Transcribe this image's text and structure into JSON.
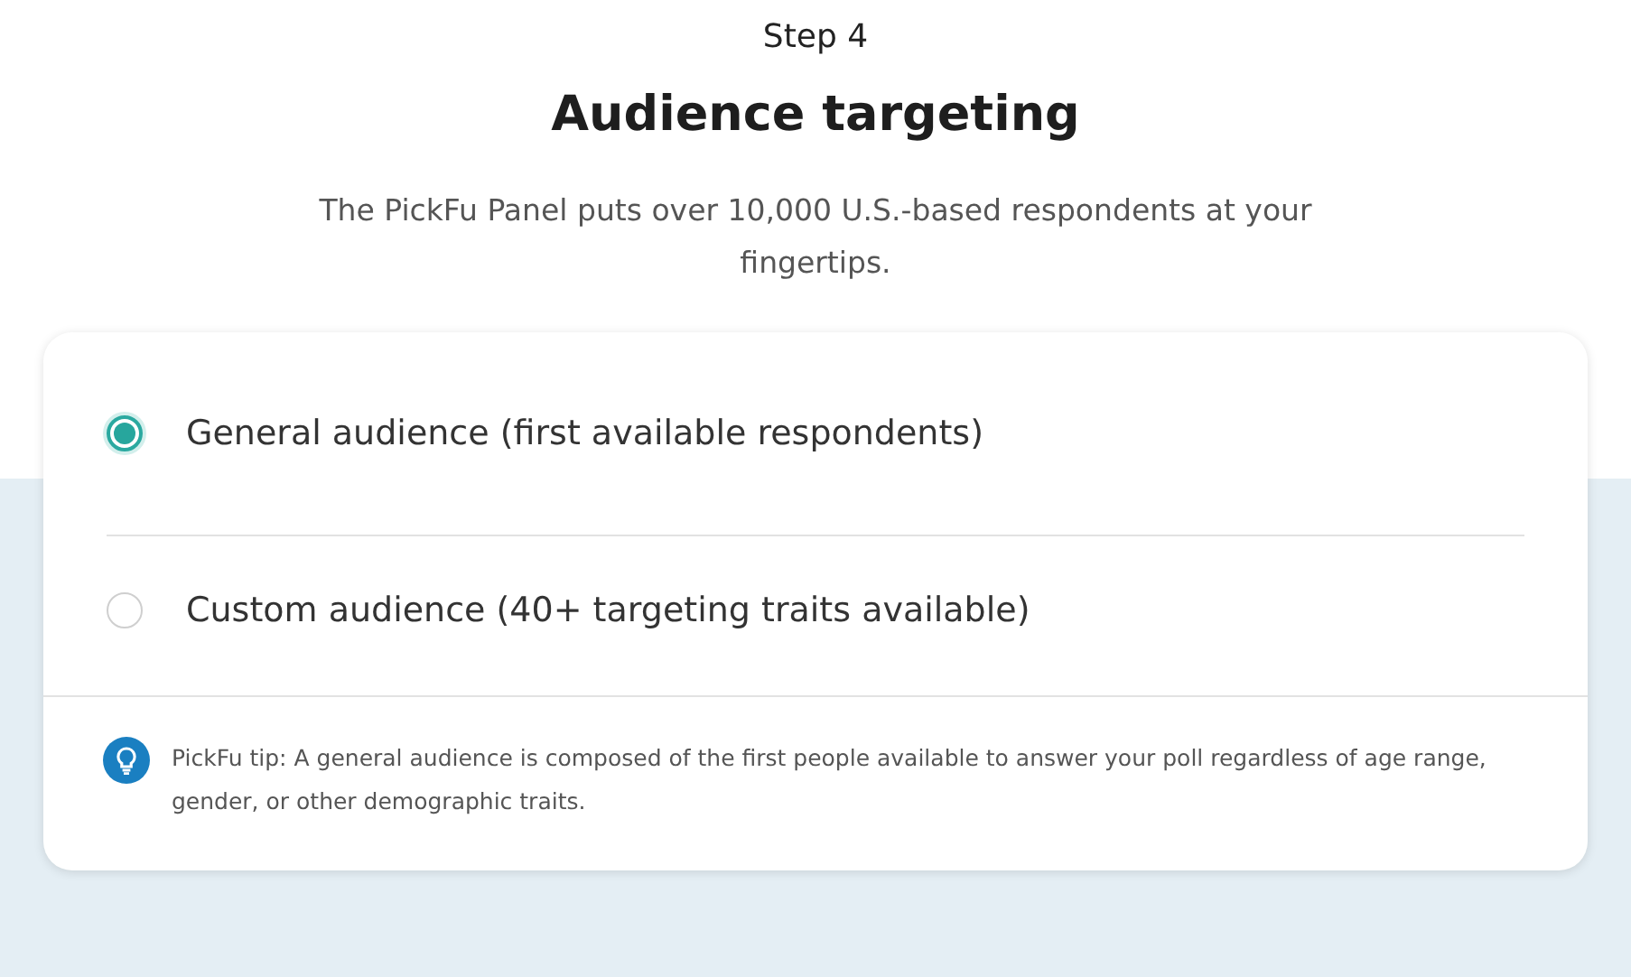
{
  "step": "Step 4",
  "title": "Audience targeting",
  "subtitle": "The PickFu Panel puts over 10,000 U.S.-based respondents at your fingertips.",
  "options": [
    {
      "label": "General audience (first available respondents)",
      "selected": true
    },
    {
      "label": "Custom audience (40+ targeting traits available)",
      "selected": false
    }
  ],
  "tip": "PickFu tip: A general audience is composed of the first people available to answer your poll regardless of age range, gender, or other demographic traits."
}
